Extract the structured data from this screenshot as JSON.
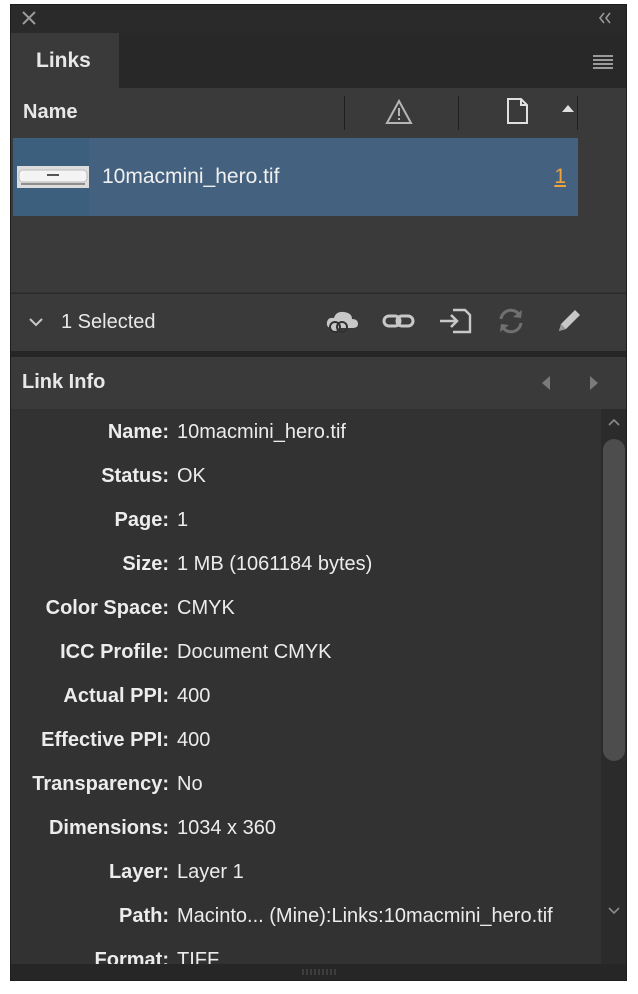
{
  "panel": {
    "tab_label": "Links",
    "column_name_label": "Name",
    "links": [
      {
        "name": "10macmini_hero.tif",
        "page": "1"
      }
    ],
    "selection": {
      "label": "1 Selected"
    },
    "toolbar": [
      "cloud-link-icon",
      "relink-icon",
      "goto-link-icon",
      "update-link-icon",
      "edit-original-icon"
    ],
    "link_info": {
      "heading": "Link Info",
      "rows": [
        {
          "key": "Name:",
          "value": "10macmini_hero.tif"
        },
        {
          "key": "Status:",
          "value": "OK"
        },
        {
          "key": "Page:",
          "value": "1"
        },
        {
          "key": "Size:",
          "value": "1 MB (1061184 bytes)"
        },
        {
          "key": "Color Space:",
          "value": "CMYK"
        },
        {
          "key": "ICC Profile:",
          "value": "Document CMYK"
        },
        {
          "key": "Actual PPI:",
          "value": "400"
        },
        {
          "key": "Effective PPI:",
          "value": "400"
        },
        {
          "key": "Transparency:",
          "value": "No"
        },
        {
          "key": "Dimensions:",
          "value": "1034 x 360"
        },
        {
          "key": "Layer:",
          "value": "Layer 1"
        },
        {
          "key": "Path:",
          "value": "Macinto... (Mine):Links:10macmini_hero.tif"
        },
        {
          "key": "Format:",
          "value": "TIFF"
        }
      ]
    },
    "colors": {
      "panel_bg": "#323232",
      "selected_row": "#44627f",
      "page_link": "#f0a33c"
    }
  }
}
